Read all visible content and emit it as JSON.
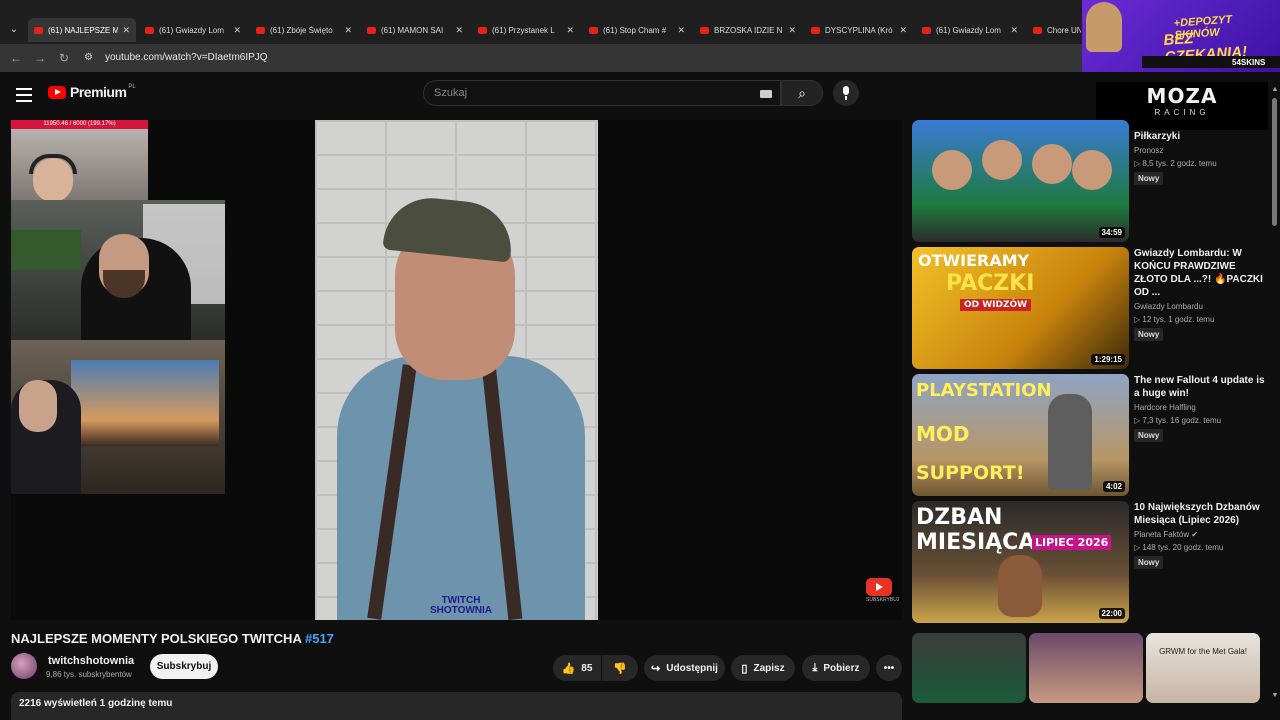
{
  "browser": {
    "tabs": [
      {
        "label": "(61) NAJLEPSZE M"
      },
      {
        "label": "(61) Gwiazdy Lom"
      },
      {
        "label": "(61) Zbóje Święto"
      },
      {
        "label": "(61) MAMON SAI"
      },
      {
        "label": "(61) Przystanek L"
      },
      {
        "label": "(61) Stop Cham #"
      },
      {
        "label": "BRZOSKA IDZIE N"
      },
      {
        "label": "DYSCYPLINA (Kró"
      },
      {
        "label": "(61) Gwiazdy Lom"
      },
      {
        "label": "Chore UNIV"
      }
    ],
    "url": "youtube.com/watch?v=DIaetm6IPJQ"
  },
  "ad_banner": {
    "line1": "+DEPOZYT SKINÓW",
    "line2": "BEZ CZEKANIA!",
    "brand": "54SKINS"
  },
  "header": {
    "logo": "Premium",
    "region": "PL",
    "search_placeholder": "Szukaj"
  },
  "overlay_ad": {
    "brand": "MOZA",
    "sub": "RACING"
  },
  "player": {
    "stream_counter": "11950.46 / 6000 (199.17%)",
    "watermark": "TWITCH SHOTOWNIA",
    "corner_label": "SUBSKRYBUJ"
  },
  "video": {
    "title": "NAJLEPSZE MOMENTY POLSKIEGO TWITCHA",
    "tag": "#517",
    "channel": "twitchshotownia",
    "subscribers": "9,86 tys. subskrybentów",
    "subscribe_label": "Subskrybuj",
    "likes": "85",
    "share_label": "Udostępnij",
    "save_label": "Zapisz",
    "download_label": "Pobierz",
    "views_line": "2216 wyświetleń  1 godzinę temu"
  },
  "sidebar": {
    "items": [
      {
        "title": "Piłkarzyki",
        "channel": "Pronosz",
        "stats": "▷ 8,5 tys.   2 godz. temu",
        "badge": "Nowy",
        "duration": "34:59"
      },
      {
        "title": "Gwiazdy Lombardu: W KOŃCU PRAWDZIWE ZŁOTO DLA ...?! 🔥PACZKI OD ...",
        "channel": "Gwiazdy Lombardu",
        "stats": "▷ 12 tys.   1 godz. temu",
        "badge": "Nowy",
        "duration": "1:29:15",
        "thumb_text1": "OTWIERAMY",
        "thumb_text2": "PACZKI",
        "thumb_text3": "OD WIDZÓW"
      },
      {
        "title": "The new Fallout 4 update is a huge win!",
        "channel": "Hardcore Halfling",
        "stats": "▷ 7,3 tys.   16 godz. temu",
        "badge": "Nowy",
        "duration": "4:02",
        "thumb_text1": "PLAYSTATION",
        "thumb_text2": "MOD",
        "thumb_text3": "SUPPORT!"
      },
      {
        "title": "10 Największych Dzbanów Miesiąca (Lipiec 2026)",
        "channel": "Planeta Faktów ✔",
        "stats": "▷ 148 tys.   20 godz. temu",
        "badge": "Nowy",
        "duration": "22:00",
        "thumb_text1": "DZBAN MIESIĄCA",
        "thumb_text2": "LIPIEC 2026"
      }
    ],
    "bottom_thumb_text": "GRWM for the Met Gala!"
  }
}
